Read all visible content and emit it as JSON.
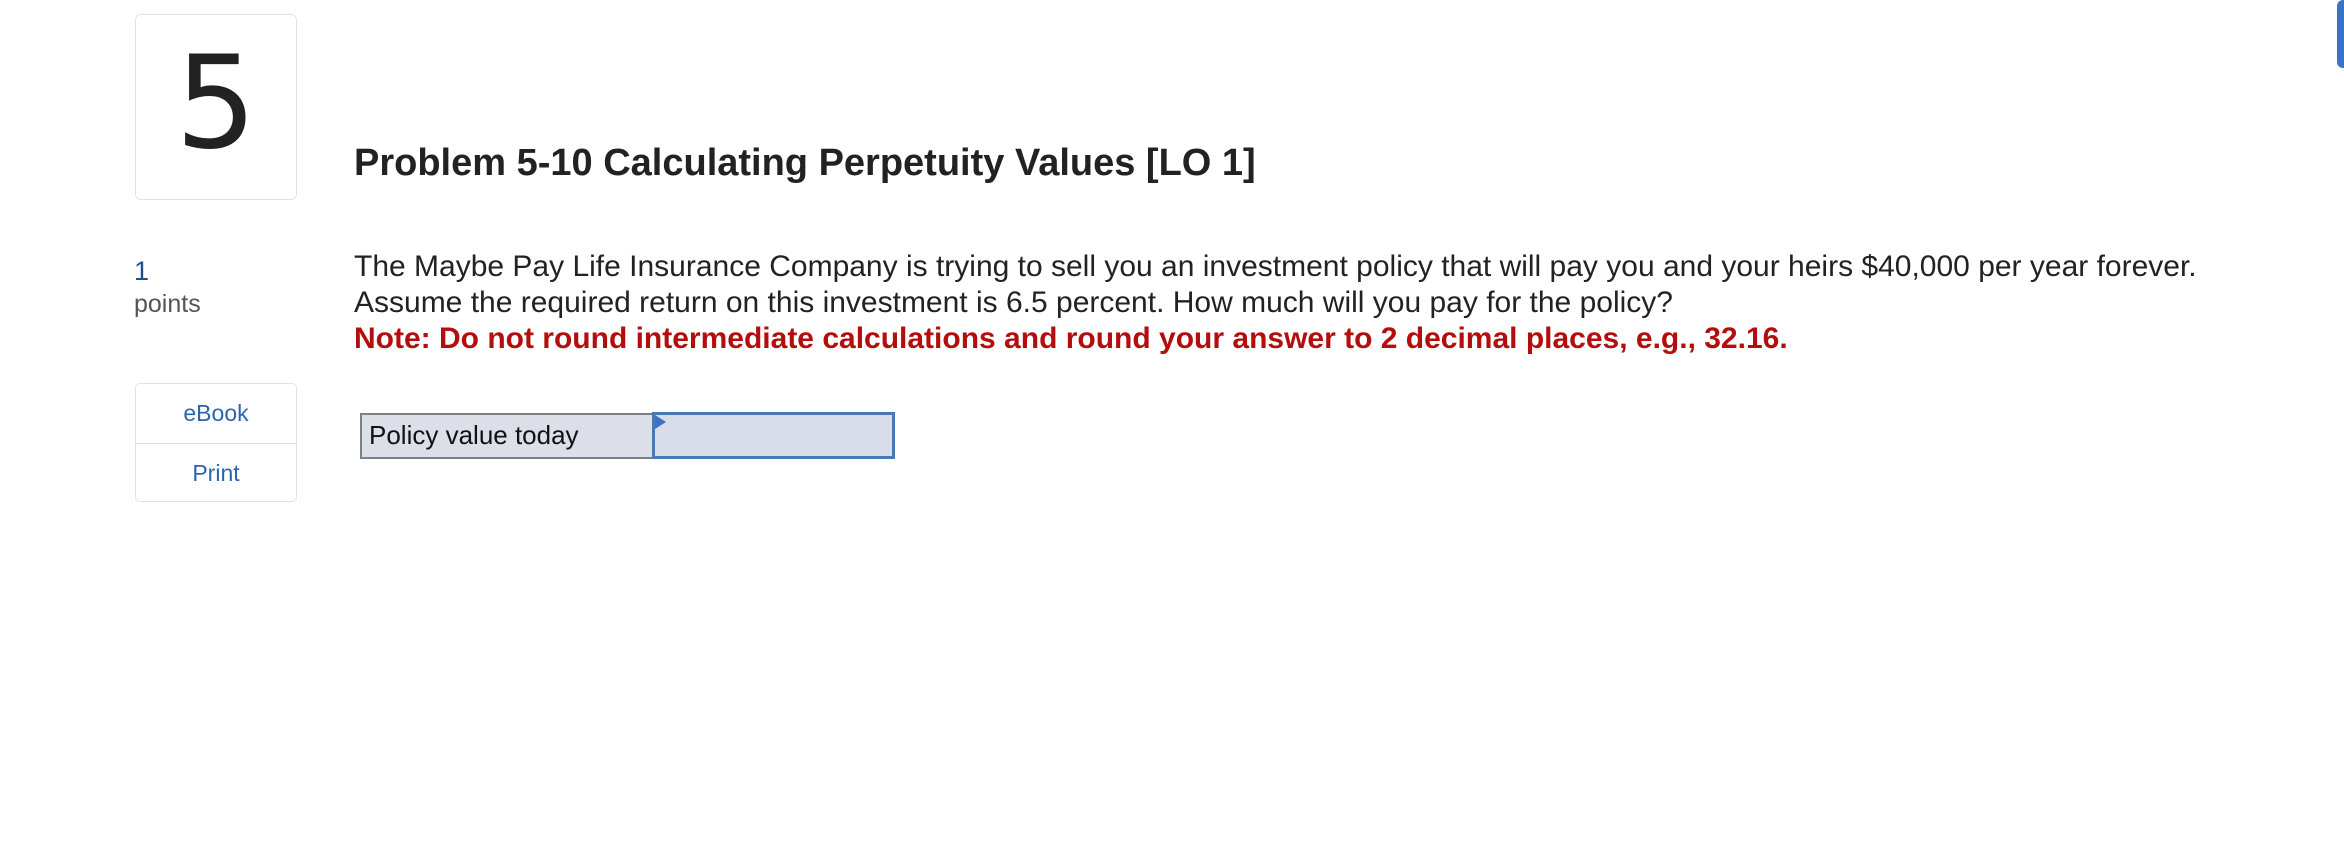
{
  "question": {
    "number": "5",
    "points_value": "1",
    "points_label": "points",
    "title": "Problem 5-10 Calculating Perpetuity Values [LO 1]",
    "text": "The Maybe Pay Life Insurance Company is trying to sell you an investment policy that will pay you and your heirs $40,000 per year forever. Assume the required return on this investment is 6.5 percent. How much will you pay for the policy?",
    "note": "Note: Do not round intermediate calculations and round your answer to 2 decimal places, e.g., 32.16."
  },
  "tools": {
    "ebook_label": "eBook",
    "print_label": "Print"
  },
  "answer": {
    "label": "Policy value today",
    "value": ""
  },
  "colors": {
    "link": "#2a66b0",
    "note": "#b30d0d",
    "input_border": "#4a78b0",
    "input_bg": "#d9dde9",
    "edge_tab": "#3a72c4"
  }
}
